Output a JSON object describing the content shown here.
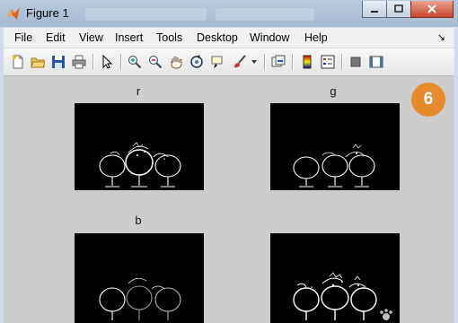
{
  "window": {
    "title": "Figure 1"
  },
  "menu": [
    "File",
    "Edit",
    "View",
    "Insert",
    "Tools",
    "Desktop",
    "Window",
    "Help"
  ],
  "toolbar": [
    {
      "icon": "new-figure-icon"
    },
    {
      "icon": "open-file-icon"
    },
    {
      "icon": "save-icon"
    },
    {
      "icon": "print-icon"
    },
    {
      "icon": "pointer-icon"
    },
    {
      "icon": "zoom-in-icon"
    },
    {
      "icon": "zoom-out-icon"
    },
    {
      "icon": "pan-hand-icon"
    },
    {
      "icon": "rotate-3d-icon"
    },
    {
      "icon": "data-cursor-icon"
    },
    {
      "icon": "brush-icon"
    },
    {
      "icon": "link-plot-icon"
    },
    {
      "icon": "colorbar-icon"
    },
    {
      "icon": "legend-icon"
    },
    {
      "icon": "hide-plot-tools-icon"
    },
    {
      "icon": "show-plot-tools-icon"
    }
  ],
  "axes": [
    {
      "title": "r"
    },
    {
      "title": "g"
    },
    {
      "title": "b"
    },
    {
      "title": ""
    }
  ],
  "badge": "6",
  "colors": {
    "figure_bg": "#cdcdcd",
    "badge": "#e68a2e",
    "axes_bg": "#000000"
  }
}
